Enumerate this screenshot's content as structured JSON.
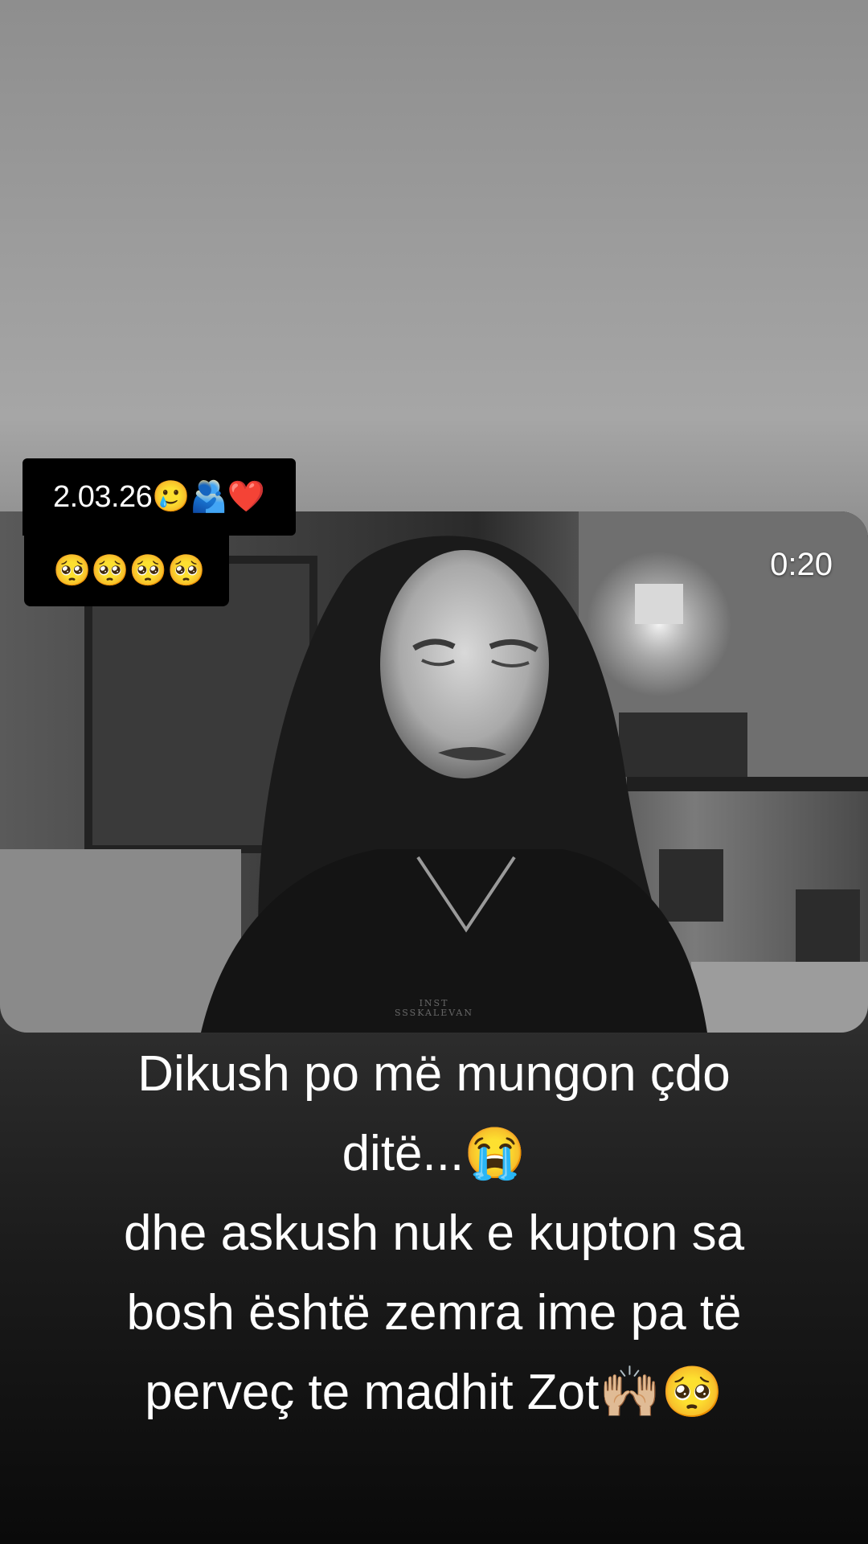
{
  "stickers": {
    "date_text": "2.03.26🥲🫂❤️",
    "faces_text": "🥺🥺🥺🥺"
  },
  "video": {
    "timestamp": "0:20",
    "watermark_line1": "INST",
    "watermark_line2": "SSSKALEVAN"
  },
  "caption": {
    "lines": [
      "Dikush po më mungon çdo",
      "ditë...😭",
      "dhe askush nuk e kupton sa",
      "bosh është zemra ime pa të",
      "perveç te madhit Zot🙌🏼🥺"
    ]
  }
}
